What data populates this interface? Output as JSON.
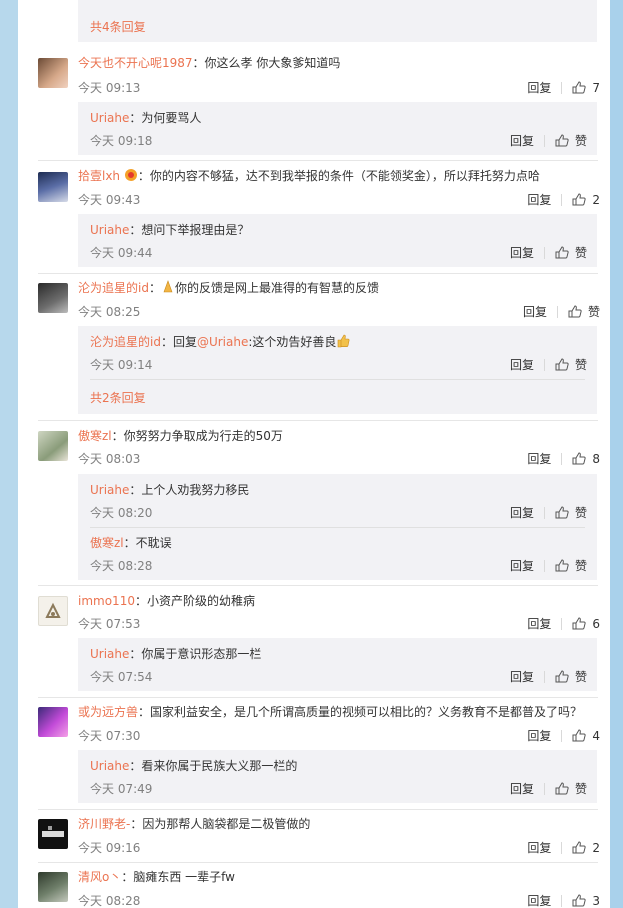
{
  "top_more": "共4条回复",
  "reply_label": "回复",
  "zan_label": "赞",
  "comments": [
    {
      "name": "今天也不开心呢1987",
      "text": "：你这么孝 你大象爹知道吗",
      "time": "今天 09:13",
      "likes": "7",
      "replies": [
        {
          "name": "Uriahe",
          "text": "：为何要骂人",
          "time": "今天 09:18"
        }
      ]
    },
    {
      "name": "拾壹lxh",
      "text": "：你的内容不够猛，达不到我举报的条件（不能领奖金），所以拜托努力点哈",
      "time": "今天 09:43",
      "likes": "2",
      "replies": [
        {
          "name": "Uriahe",
          "text": "：想问下举报理由是？",
          "time": "今天 09:44"
        }
      ]
    },
    {
      "name": "沦为追星的id",
      "text": "你的反馈是网上最准得的有智慧的反馈",
      "time": "今天 08:25",
      "likes": "",
      "replies": [
        {
          "name": "沦为追星的id",
          "text": "：回复",
          "mention": "@Uriahe",
          "text2": ":这个劝告好善良",
          "time": "今天 09:14"
        }
      ],
      "more": "共2条回复"
    },
    {
      "name": "傲寒zl",
      "text": "：你努努力争取成为行走的50万",
      "time": "今天 08:03",
      "likes": "8",
      "replies": [
        {
          "name": "Uriahe",
          "text": "：上个人劝我努力移民",
          "time": "今天 08:20"
        },
        {
          "name": "傲寒zl",
          "text": "：不耽误",
          "time": "今天 08:28"
        }
      ]
    },
    {
      "name": "immo110",
      "text": "：小资产阶级的幼稚病",
      "time": "今天 07:53",
      "likes": "6",
      "replies": [
        {
          "name": "Uriahe",
          "text": "：你属于意识形态那一栏",
          "time": "今天 07:54"
        }
      ]
    },
    {
      "name": "或为远方兽",
      "text": "：国家利益安全，是几个所谓高质量的视频可以相比的？义务教育不是都普及了吗？",
      "time": "今天 07:30",
      "likes": "4",
      "replies": [
        {
          "name": "Uriahe",
          "text": "：看来你属于民族大义那一栏的",
          "time": "今天 07:49"
        }
      ]
    },
    {
      "name": "济川野老-",
      "text": "：因为那帮人脑袋都是二极管做的",
      "time": "今天 09:16",
      "likes": "2",
      "replies": []
    },
    {
      "name": "清风o丶",
      "text": "：脑瘫东西 一辈子fw",
      "time": "今天 08:28",
      "likes": "3",
      "replies": []
    }
  ]
}
